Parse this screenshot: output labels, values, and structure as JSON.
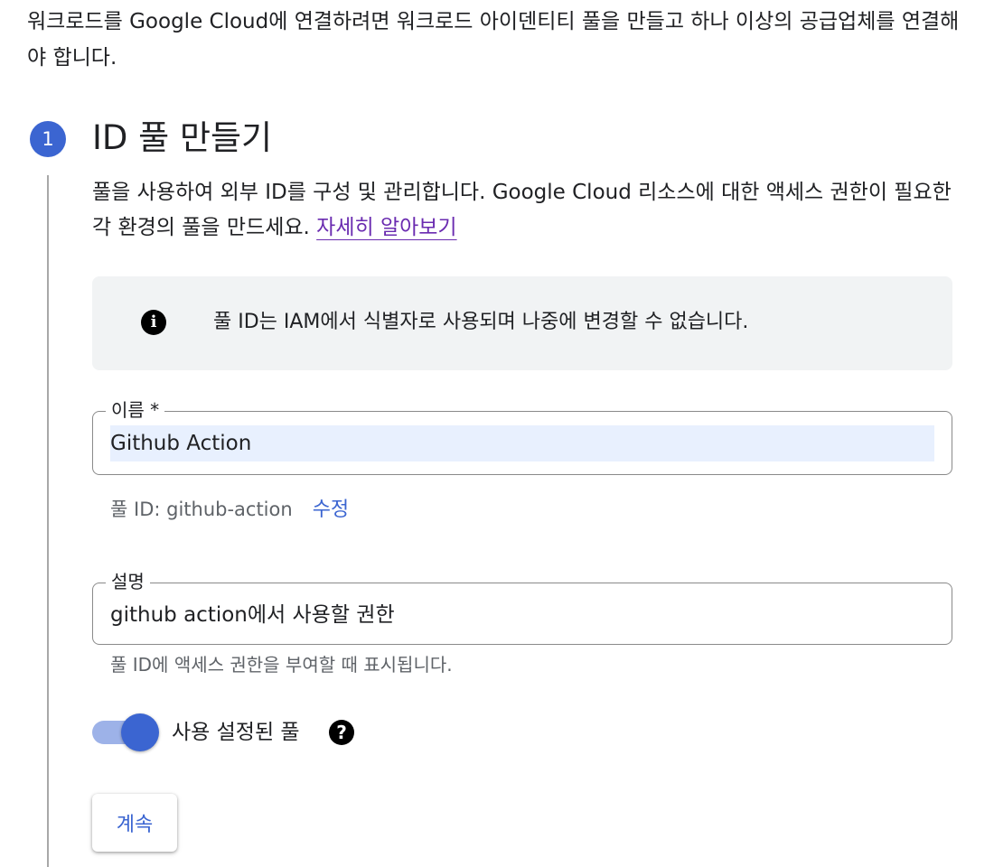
{
  "intro_text": "워크로드를 Google Cloud에 연결하려면 워크로드 아이덴티티 풀을 만들고 하나 이상의 공급업체를 연결해야 합니다.",
  "step": {
    "number": "1",
    "title": "ID 풀 만들기",
    "description": "풀을 사용하여 외부 ID를 구성 및 관리합니다. Google Cloud 리소스에 대한 액세스 권한이 필요한 각 환경의 풀을 만드세요. ",
    "learn_more": "자세히 알아보기"
  },
  "info_banner": {
    "icon": "info-icon",
    "text": "풀 ID는 IAM에서 식별자로 사용되며 나중에 변경할 수 없습니다."
  },
  "name_field": {
    "label": "이름 *",
    "value": "Github Action"
  },
  "pool_id": {
    "text": "풀 ID: github-action",
    "edit_label": "수정"
  },
  "description_field": {
    "label": "설명",
    "value": "github action에서 사용할 권한",
    "hint": "풀 ID에 액세스 권한을 부여할 때 표시됩니다."
  },
  "enabled_toggle": {
    "label": "사용 설정된 풀",
    "checked": true,
    "help_icon": "help-icon"
  },
  "continue_button": "계속",
  "colors": {
    "accent": "#3b65d1",
    "link_visited": "#6a2bb0",
    "banner_bg": "#f1f3f4",
    "toggle_track": "#9db2e8"
  }
}
